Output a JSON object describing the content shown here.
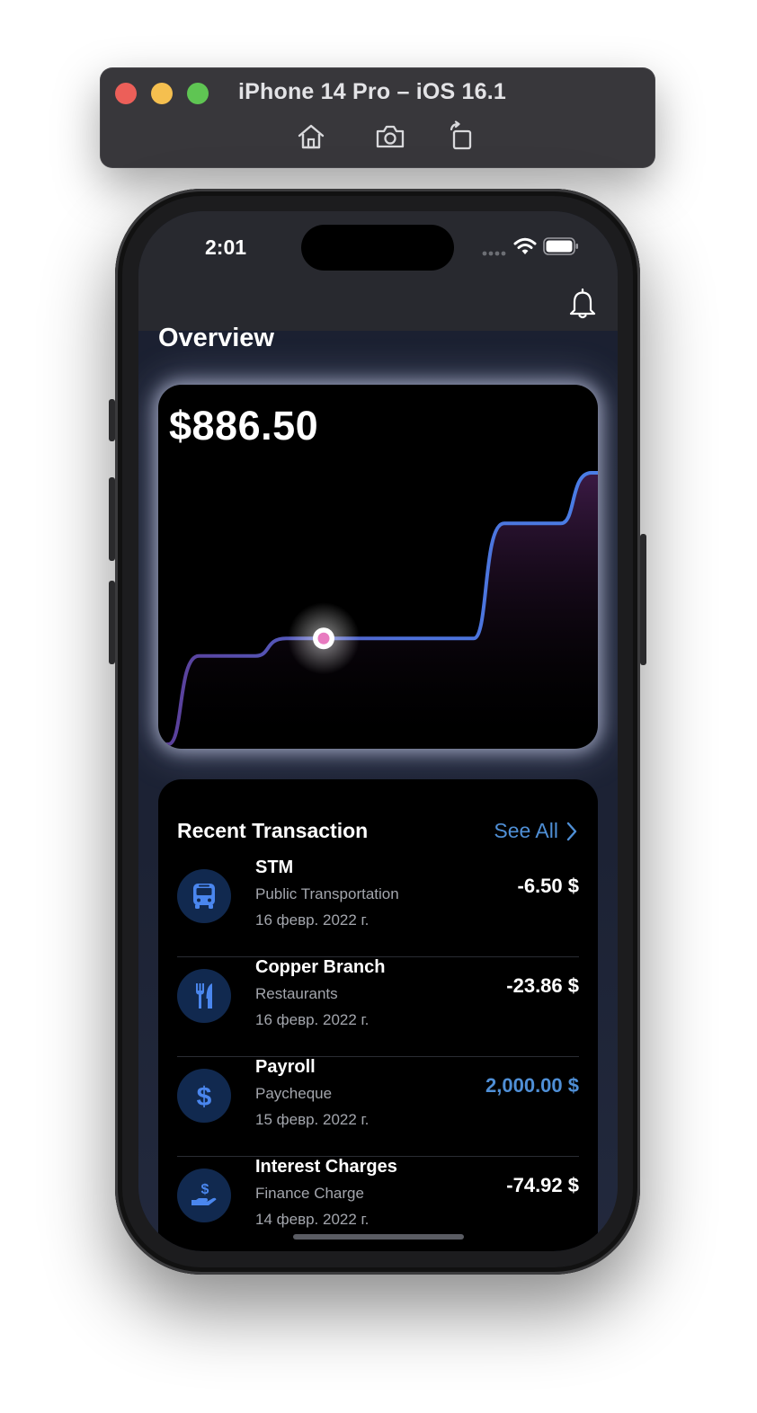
{
  "window": {
    "title": "iPhone 14 Pro – iOS 16.1",
    "toolbar": [
      {
        "icon": "home-icon",
        "label": "Home"
      },
      {
        "icon": "camera-icon",
        "label": "Screenshot"
      },
      {
        "icon": "rotate-icon",
        "label": "Rotate"
      }
    ]
  },
  "status_bar": {
    "time": "2:01"
  },
  "header": {
    "title": "Overview",
    "bell_icon": "bell-icon"
  },
  "balance_card": {
    "balance": "$886.50",
    "line_color_start": "#5b3e98",
    "line_color_end": "#4a7ee6",
    "marker_color": "#e87bc0"
  },
  "chart_data": {
    "type": "line",
    "title": "",
    "xlabel": "",
    "ylabel": "",
    "x": [
      0,
      1,
      2,
      3,
      4,
      5,
      6,
      7,
      8,
      9,
      10
    ],
    "series": [
      {
        "values": [
          0,
          96,
          96,
          115,
          115,
          115,
          115,
          115,
          240,
          240,
          295
        ]
      }
    ],
    "highlight_index": 4
  },
  "transactions": {
    "title": "Recent Transaction",
    "see_all": "See All",
    "items": [
      {
        "name": "STM",
        "category": "Public Transportation",
        "date": "16 февр. 2022 г.",
        "amount": "-6.50 $",
        "positive": false,
        "icon": "bus-icon"
      },
      {
        "name": "Copper Branch",
        "category": "Restaurants",
        "date": "16 февр. 2022 г.",
        "amount": "-23.86 $",
        "positive": false,
        "icon": "fork-knife-icon"
      },
      {
        "name": "Payroll",
        "category": "Paycheque",
        "date": "15 февр. 2022 г.",
        "amount": "2,000.00 $",
        "positive": true,
        "icon": "dollar-icon"
      },
      {
        "name": "Interest Charges",
        "category": "Finance Charge",
        "date": "14 февр. 2022 г.",
        "amount": "-74.92 $",
        "positive": false,
        "icon": "hand-dollar-icon"
      }
    ]
  }
}
